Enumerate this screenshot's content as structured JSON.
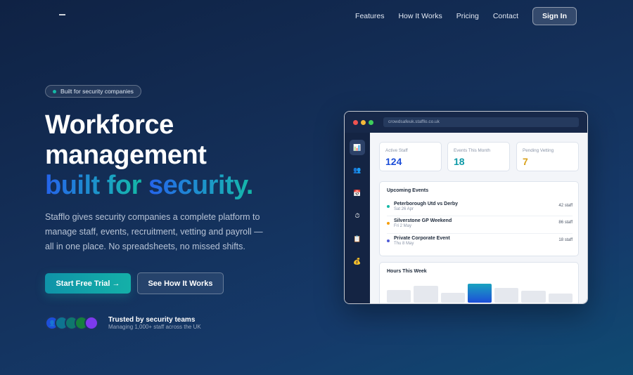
{
  "nav": {
    "links": [
      "Features",
      "How It Works",
      "Pricing",
      "Contact"
    ],
    "signin": "Sign In"
  },
  "hero": {
    "badge": "Built for security companies",
    "line1": "Workforce",
    "line2": "management",
    "line3a": "built for",
    "line3b": "security.",
    "sub": "Stafflo gives security companies a complete platform to manage staff, events, recruitment, vetting and payroll — all in one place. No spreadsheets, no missed shifts.",
    "cta_primary": "Start Free Trial →",
    "cta_secondary": "See How It Works",
    "trust_title": "Trusted by security teams",
    "trust_sub": "Managing 1,000+ staff across the UK"
  },
  "avatars": [
    {
      "color": "#1d4ed8",
      "icon": "user-icon",
      "glyph": "👤"
    },
    {
      "color": "#0e7490",
      "icon": "user-icon",
      "glyph": ""
    },
    {
      "color": "#0f766e",
      "icon": "user-icon",
      "glyph": ""
    },
    {
      "color": "#15803d",
      "icon": "user-icon",
      "glyph": ""
    },
    {
      "color": "#7c3aed",
      "icon": "user-icon",
      "glyph": ""
    }
  ],
  "mockup": {
    "url": "crowdsafeuk.stafflo.co.uk",
    "sidebar_icons": [
      {
        "name": "chart-icon",
        "glyph": "📊",
        "active": true
      },
      {
        "name": "users-icon",
        "glyph": "👥",
        "active": false
      },
      {
        "name": "calendar-icon",
        "glyph": "📅",
        "active": false
      },
      {
        "name": "clock-icon",
        "glyph": "⏱",
        "active": false
      },
      {
        "name": "clipboard-icon",
        "glyph": "📋",
        "active": false
      },
      {
        "name": "money-bag-icon",
        "glyph": "💰",
        "active": false
      }
    ],
    "stats": [
      {
        "label": "Active Staff",
        "value": "124",
        "color": "#1d4ed8"
      },
      {
        "label": "Events This Month",
        "value": "18",
        "color": "#0e9aa7"
      },
      {
        "label": "Pending Vetting",
        "value": "7",
        "color": "#d9a21b"
      }
    ],
    "events_title": "Upcoming Events",
    "events": [
      {
        "name": "Peterborough Utd vs Derby",
        "date": "Sat 26 Apr",
        "staff": "42 staff",
        "color": "#14b8a6"
      },
      {
        "name": "Silverstone GP Weekend",
        "date": "Fri 2 May",
        "staff": "86 staff",
        "color": "#f59e0b"
      },
      {
        "name": "Private Corporate Event",
        "date": "Thu 8 May",
        "staff": "18 staff",
        "color": "#4f5bd5"
      }
    ],
    "hours_title": "Hours This Week",
    "hours_bars": [
      0.61,
      0.81,
      0.48,
      0.9,
      0.71,
      0.58,
      0.42
    ],
    "highlight_bar": 3
  }
}
